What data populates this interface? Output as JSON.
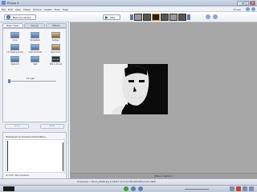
{
  "window": {
    "title": "Picasa 3"
  },
  "menu": {
    "items": [
      "File",
      "Edit",
      "View",
      "Folder",
      "Picture",
      "Create",
      "Tools",
      "Help"
    ],
    "brand": "Picasa"
  },
  "toolbar": {
    "back_label": "Back to Library",
    "play_label": "Play"
  },
  "tabs": [
    {
      "label": "Basic Fixes",
      "active": true
    },
    {
      "label": "Tuning",
      "active": false
    },
    {
      "label": "Effects",
      "active": false
    }
  ],
  "fixes": [
    {
      "label": "Crop",
      "icon": "crop-icon"
    },
    {
      "label": "Straighten",
      "icon": "straighten-icon"
    },
    {
      "label": "Redeye",
      "icon": "redeye-icon"
    },
    {
      "label": "I'm Feeling Lucky",
      "icon": "lucky-icon"
    },
    {
      "label": "Auto Contrast",
      "icon": "auto-contrast-icon"
    },
    {
      "label": "Auto Color",
      "icon": "auto-color-icon"
    },
    {
      "label": "Retouch",
      "icon": "retouch-icon"
    },
    {
      "label": "Text",
      "icon": "text-icon"
    },
    {
      "label": "Edit in Picnik",
      "icon": "picnik-icon"
    }
  ],
  "fill_light": {
    "label": "Fill Light",
    "value": 0
  },
  "undo_label": "Undo",
  "redo_label": "Redo",
  "histogram": {
    "title": "Histogram & Camera Information",
    "note": "No EXIF data available"
  },
  "caption": "Make a caption!",
  "status": {
    "file": "Downloads > Photo_00000.jpg   1/1/2013 12:57:03 PM   640x480 pixels   39KB"
  },
  "colors": {
    "viewer_bg": "#a7a7a7",
    "panel_bg": "#e8ebf0",
    "accent": "#e58a1f"
  }
}
